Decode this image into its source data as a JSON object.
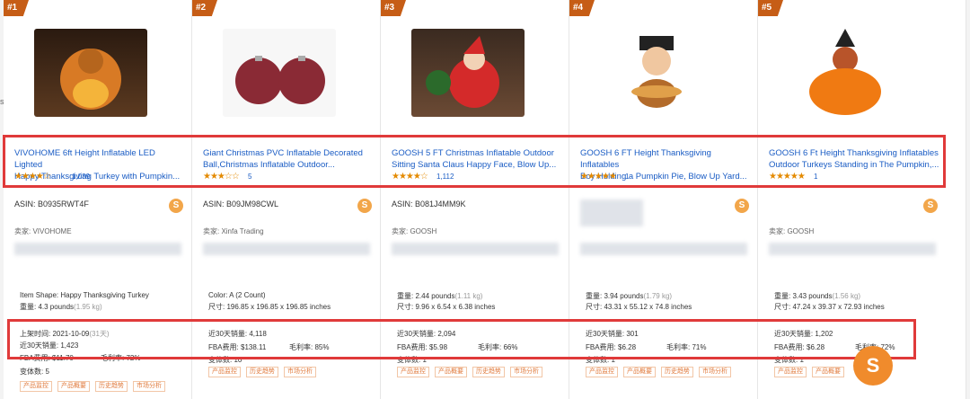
{
  "products": [
    {
      "rank": "#1",
      "title_line1": "VIVOHOME 6ft Height Inflatable LED Lighted",
      "title_line2": "Happy Thanksgiving Turkey with Pumpkin...",
      "stars": "★★★★☆",
      "reviews": "1,039",
      "asin": "ASIN: B0935RWT4F",
      "seller_label": "卖家: VIVOHOME",
      "category": "...",
      "attr_line1": "Item Shape: Happy Thanksgiving Turkey",
      "weight_label": "重量: 4.3 pounds",
      "weight_kg": "(1.95 kg)",
      "size_line": "",
      "listing_label": "上架时间: 2021-10-09",
      "listing_extra": "(31天)",
      "sales_30d": "近30天销量: 1,423",
      "fba_fee": "FBA费用: $11.70",
      "margin": "毛利率: 72%",
      "variants": "变体数: 5",
      "tags": [
        "产品监控",
        "产品概要",
        "历史趋势",
        "市场分析"
      ]
    },
    {
      "rank": "#2",
      "title_line1": "Giant Christmas PVC Inflatable Decorated",
      "title_line2": "Ball,Christmas Inflatable Outdoor...",
      "stars": "★★★☆☆",
      "reviews": "5",
      "asin": "ASIN: B09JM98CWL",
      "seller_label": "卖家: Xinfa Trading",
      "category": "...ations",
      "attr_line1": "Color: A (2 Count)",
      "weight_label": "尺寸: 196.85 x 196.85 x 196.85 inches",
      "weight_kg": "",
      "size_line": "",
      "listing_label": "",
      "listing_extra": "",
      "sales_30d": "近30天销量: 4,118",
      "fba_fee": "FBA费用: $138.11",
      "margin": "毛利率: 85%",
      "variants": "变体数: 10",
      "tags": [
        "产品监控",
        "历史趋势",
        "市场分析"
      ]
    },
    {
      "rank": "#3",
      "title_line1": "GOOSH 5 FT Christmas Inflatable Outdoor",
      "title_line2": "Sitting Santa Claus Happy Face, Blow Up...",
      "stars": "★★★★☆",
      "reviews": "1,112",
      "asin": "ASIN: B081J4MM9K",
      "seller_label": "卖家: GOOSH",
      "category": "...ations",
      "attr_line1": "重量: 2.44 pounds",
      "weight_label": "尺寸: 9.96 x 6.54 x 6.38 inches",
      "weight_kg": "(1.11 kg)",
      "size_line": "",
      "listing_label": "",
      "listing_extra": "",
      "sales_30d": "近30天销量: 2,094",
      "fba_fee": "FBA费用: $5.98",
      "margin": "毛利率: 66%",
      "variants": "变体数: 1",
      "tags": [
        "产品监控",
        "产品概要",
        "历史趋势",
        "市场分析"
      ]
    },
    {
      "rank": "#4",
      "title_line1": "GOOSH 6 FT Height Thanksgiving Inflatables",
      "title_line2": "Boy Holding a Pumpkin Pie, Blow Up Yard...",
      "stars": "★★★★★",
      "reviews": "1",
      "asin": "",
      "seller_label": "",
      "category": "...ations",
      "attr_line1": "重量: 3.94 pounds",
      "weight_label": "尺寸: 43.31 x 55.12 x 74.8 inches",
      "weight_kg": "(1.79 kg)",
      "size_line": "",
      "listing_label": "",
      "listing_extra": "",
      "sales_30d": "近30天销量: 301",
      "fba_fee": "FBA费用: $6.28",
      "margin": "毛利率: 71%",
      "variants": "变体数: 1",
      "tags": [
        "产品监控",
        "产品概要",
        "历史趋势",
        "市场分析"
      ]
    },
    {
      "rank": "#5",
      "title_line1": "GOOSH 6 Ft Height Thanksgiving Inflatables",
      "title_line2": "Outdoor Turkeys Standing in The Pumpkin,...",
      "stars": "★★★★★",
      "reviews": "1",
      "asin": "",
      "seller_label": "卖家: GOOSH",
      "category": "...ations",
      "attr_line1": "重量: 3.43 pounds",
      "weight_label": "尺寸: 47.24 x 39.37 x 72.93 inches",
      "weight_kg": "(1.56 kg)",
      "size_line": "",
      "listing_label": "",
      "listing_extra": "",
      "sales_30d": "近30天销量: 1,202",
      "fba_fee": "FBA费用: $6.28",
      "margin": "毛利率: 72%",
      "variants": "变体数: 1",
      "tags": [
        "产品监控",
        "产品概要",
        "历史趋势",
        "市场分析"
      ]
    }
  ],
  "sidebar_fragment": "s",
  "colors": {
    "accent": "#c65d16",
    "link": "#1a5cc4",
    "highlight": "#e03a3a"
  }
}
